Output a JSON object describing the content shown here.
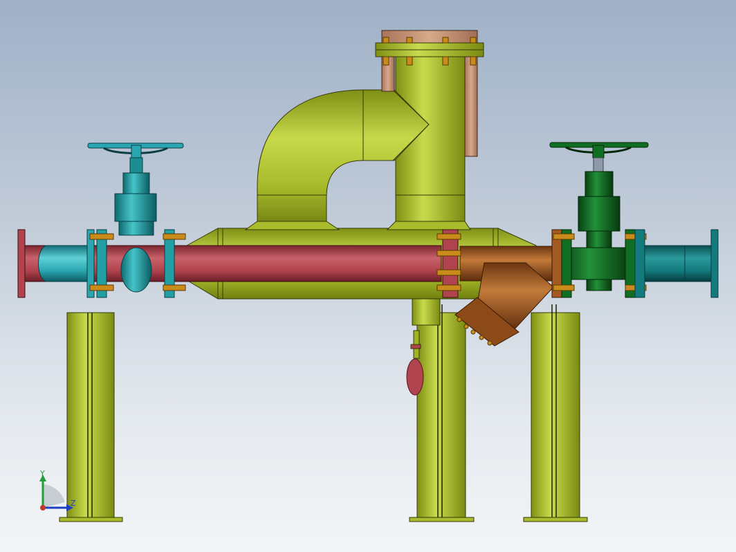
{
  "viewport": {
    "background_top": "#9fb0c7",
    "background_bottom": "#f3f5f7"
  },
  "model": {
    "parts": {
      "main_pipe": {
        "color": "#b0434d"
      },
      "left_nozzle": {
        "color": "#2aa6b0"
      },
      "right_nozzle": {
        "color": "#137a7d"
      },
      "separator_body": {
        "color": "#9fb324"
      },
      "cover_plate": {
        "color": "#cc9a7c"
      },
      "left_valve": {
        "color": "#23a0a4",
        "icon": "handwheel-icon"
      },
      "right_valve": {
        "color": "#0f6e22",
        "icon": "handwheel-icon"
      },
      "strainer": {
        "color": "#a35a22"
      },
      "supports": {
        "color": "#9fb324",
        "count": 3
      },
      "bolts": {
        "color": "#c98b1a"
      }
    }
  },
  "triad": {
    "y_label": "Y",
    "z_label": "Z",
    "y_color": "#1f9e3a",
    "z_color": "#1e3fbf",
    "x_color": "#c0392b"
  }
}
